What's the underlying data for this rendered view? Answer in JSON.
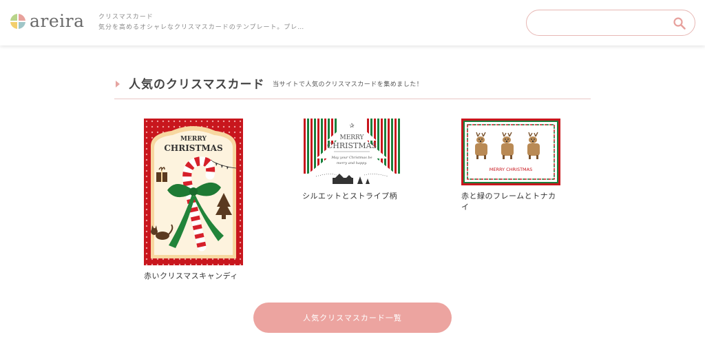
{
  "header": {
    "logo_text": "areira",
    "site_name": "クリスマスカード",
    "site_desc": "気分を高めるオシャレなクリスマスカードのテンプレート。プレ…",
    "search_placeholder": ""
  },
  "section": {
    "title": "人気のクリスマスカード",
    "subtitle": "当サイトで人気のクリスマスカードを集めました！"
  },
  "cards": [
    {
      "label": "赤いクリスマスキャンディ",
      "art_top": "MERRY",
      "art_bottom": "CHRISTMAS"
    },
    {
      "label": "シルエットとストライプ柄",
      "art_top": "MERRY",
      "art_bottom": "CHRISTMAS",
      "art_msg1": "May your Christmas be",
      "art_msg2": "merry and happy."
    },
    {
      "label": "赤と緑のフレームとトナカイ",
      "art_text": "MERRY CHRISTMAS"
    }
  ],
  "button": {
    "label": "人気クリスマスカード一覧"
  },
  "colors": {
    "accent": "#eca4a0",
    "line": "#e9c6c4",
    "red": "#c8161d",
    "green": "#1a7f3c"
  }
}
